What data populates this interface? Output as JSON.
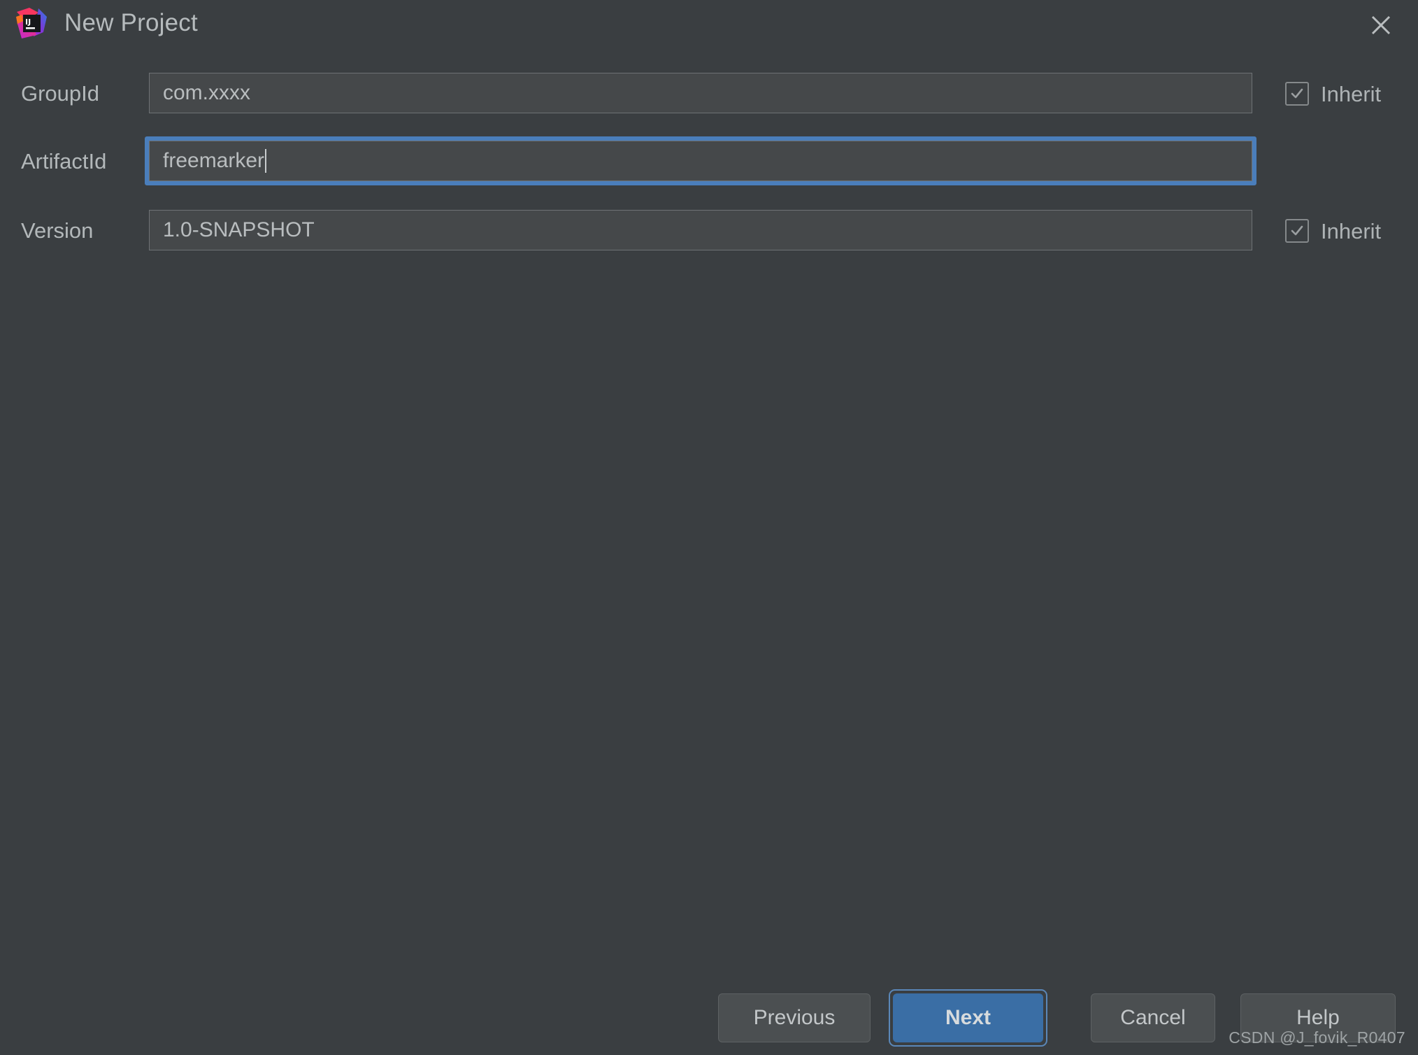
{
  "window": {
    "title": "New Project",
    "logo_icon": "intellij-idea-logo",
    "close_icon": "close-icon",
    "background_color": "#3a3e41"
  },
  "form": {
    "fields": [
      {
        "label": "GroupId",
        "value": "com.xxxx",
        "focused": false,
        "inherit": {
          "label": "Inherit",
          "checked": true
        }
      },
      {
        "label": "ArtifactId",
        "value": "freemarker",
        "focused": true,
        "inherit": null
      },
      {
        "label": "Version",
        "value": "1.0-SNAPSHOT",
        "focused": false,
        "inherit": {
          "label": "Inherit",
          "checked": true
        }
      }
    ]
  },
  "footer": {
    "previous_label": "Previous",
    "next_label": "Next",
    "cancel_label": "Cancel",
    "help_label": "Help",
    "primary_color": "#3a6ea5",
    "focus_ring_color": "#4a7ebb"
  },
  "watermark": {
    "text": "CSDN @J_fovik_R0407"
  }
}
